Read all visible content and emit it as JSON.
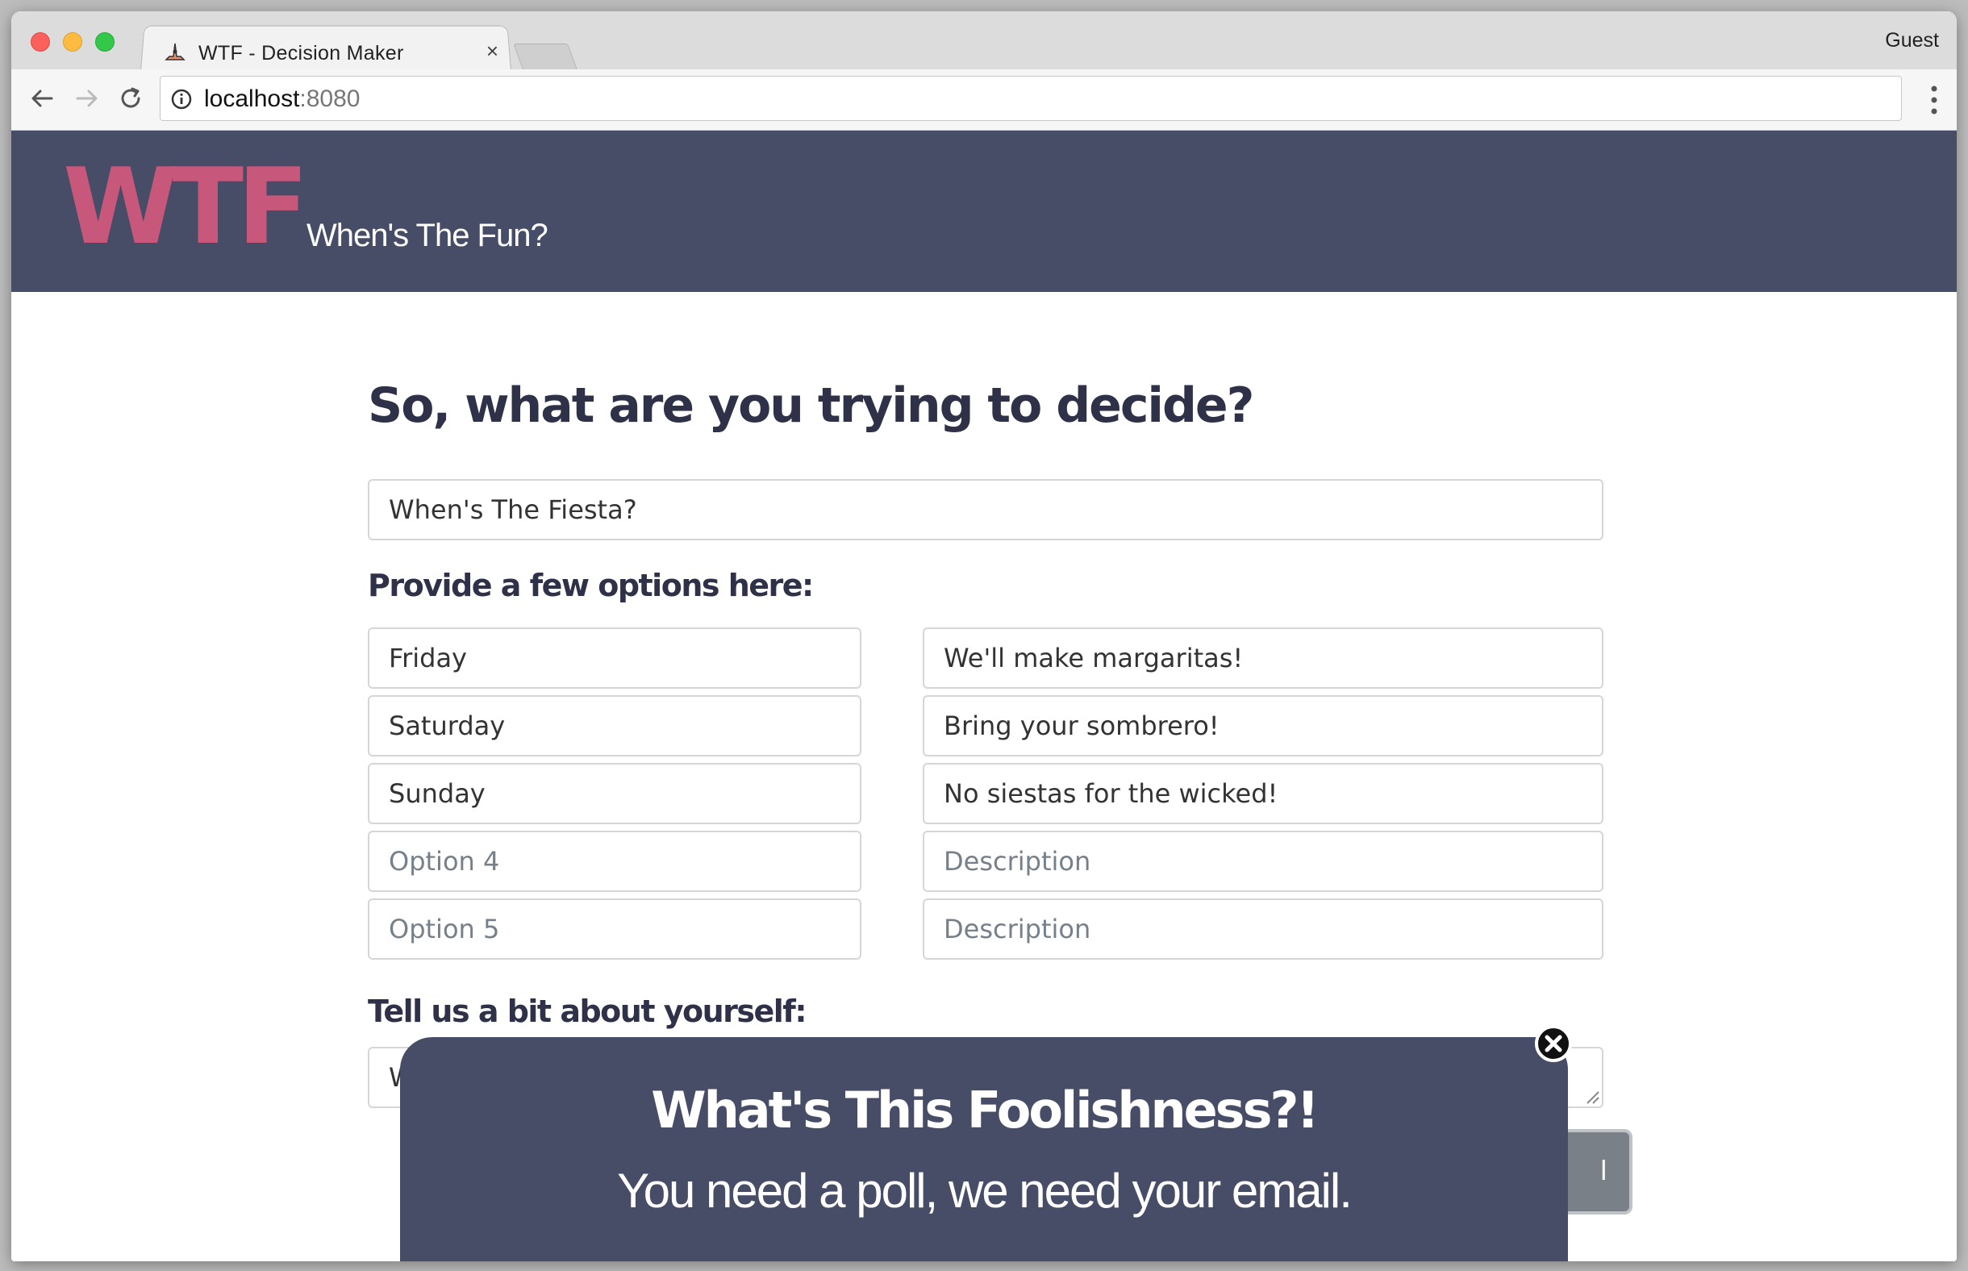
{
  "browser": {
    "tab_title": "WTF - Decision Maker",
    "tab_close": "×",
    "profile": "Guest",
    "url_host": "localhost",
    "url_port": ":8080"
  },
  "header": {
    "logo": "WTF",
    "tagline": "When's The Fun?"
  },
  "form": {
    "heading": "So, what are you trying to decide?",
    "title_value": "When's The Fiesta?",
    "options_heading": "Provide a few options here:",
    "options": [
      {
        "option": "Friday",
        "description": "We'll make margaritas!"
      },
      {
        "option": "Saturday",
        "description": "Bring your sombrero!"
      },
      {
        "option": "Sunday",
        "description": "No siestas for the wicked!"
      },
      {
        "option_placeholder": "Option 4",
        "description_placeholder": "Description"
      },
      {
        "option_placeholder": "Option 5",
        "description_placeholder": "Description"
      }
    ],
    "about_heading": "Tell us a bit about yourself:",
    "about_partial": "W",
    "submit_partial": "l"
  },
  "modal": {
    "title": "What's This Foolishness?!",
    "subtitle": "You need a poll, we need your email."
  },
  "colors": {
    "header_bg": "#484d67",
    "logo": "#c8577c",
    "heading_text": "#2e3147"
  }
}
